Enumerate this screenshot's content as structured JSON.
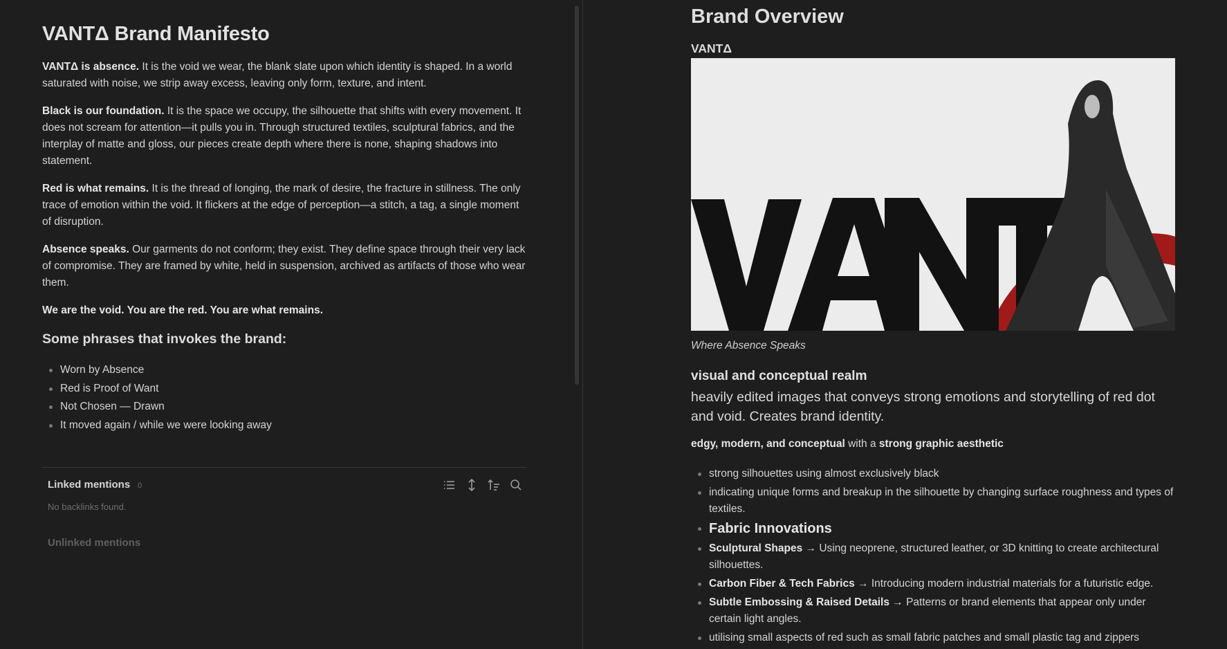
{
  "left": {
    "title": "VANTΔ Brand Manifesto",
    "paragraphs": [
      {
        "bold": "VANTΔ is absence.",
        "text": " It is the void we wear, the blank slate upon which identity is shaped. In a world saturated with noise, we strip away excess, leaving only form, texture, and intent."
      },
      {
        "bold": "Black is our foundation.",
        "text": " It is the space we occupy, the silhouette that shifts with every movement. It does not scream for attention—it pulls you in. Through structured textiles, sculptural fabrics, and the interplay of matte and gloss, our pieces create depth where there is none, shaping shadows into statement."
      },
      {
        "bold": "Red is what remains.",
        "text": " It is the thread of longing, the mark of desire, the fracture in stillness. The only trace of emotion within the void. It flickers at the edge of perception—a stitch, a tag, a single moment of disruption."
      },
      {
        "bold": "Absence speaks.",
        "text": " Our garments do not conform; they exist. They define space through their very lack of compromise. They are framed by white, held in suspension, archived as artifacts of those who wear them."
      },
      {
        "bold": "We are the void. You are the red. You are what remains.",
        "text": ""
      }
    ],
    "phrases_heading": "Some phrases that invokes the brand:",
    "phrases": [
      "Worn by Absence",
      "Red is Proof of Want",
      "Not Chosen — Drawn",
      "It moved again / while we were looking away"
    ],
    "linked_mentions": {
      "label": "Linked mentions",
      "count": "0",
      "empty": "No backlinks found."
    },
    "unlinked_mentions": "Unlinked mentions",
    "toolbar_icons": [
      "list-icon",
      "expand-vertical-icon",
      "sort-icon",
      "search-icon"
    ]
  },
  "right": {
    "title": "Brand Overview",
    "brand": "VANTΔ",
    "hero_logo": "VANTΔ",
    "caption": "Where Absence Speaks",
    "realm_heading": "visual and conceptual realm",
    "realm_text": "heavily edited images that conveys strong emotions and storytelling of red dot and void. Creates brand identity.",
    "aesthetic": {
      "part1": "edgy, modern, and conceptual",
      "part2": " with a ",
      "part3": "strong graphic aesthetic"
    },
    "bullets": [
      {
        "bold": "",
        "text": "strong silhouettes using almost exclusively black"
      },
      {
        "bold": "",
        "text": "indicating unique forms and breakup in the silhouette by changing surface roughness and types of textiles."
      },
      {
        "bold": "Fabric Innovations",
        "text": "",
        "big": true
      },
      {
        "bold": "Sculptural Shapes",
        "text": " → Using neoprene, structured leather, or 3D knitting to create architectural silhouettes."
      },
      {
        "bold": "Carbon Fiber & Tech Fabrics",
        "text": " → Introducing modern industrial materials for a futuristic edge."
      },
      {
        "bold": "Subtle Embossing & Raised Details",
        "text": " → Patterns or brand elements that appear only under certain light angles."
      },
      {
        "bold": "",
        "text": "utilising small aspects of red such as small fabric patches and small plastic tag and zippers"
      }
    ]
  },
  "colors": {
    "background": "#1e1e1e",
    "text": "#d4d4d4",
    "accent_red": "#a11a1a"
  }
}
